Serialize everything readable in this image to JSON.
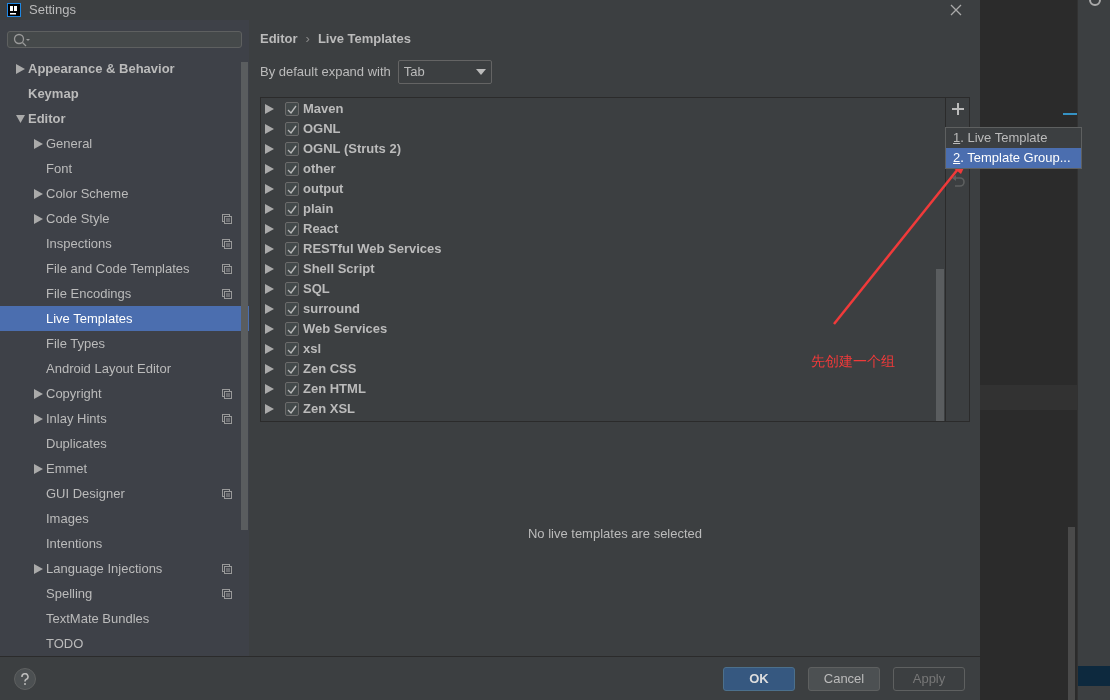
{
  "window": {
    "title": "Settings"
  },
  "sidebar": {
    "items": [
      {
        "label": "Appearance & Behavior",
        "kind": "folder",
        "expanded": false,
        "selected": false,
        "project_level": false
      },
      {
        "label": "Keymap",
        "kind": "leaf",
        "selected": false,
        "project_level": false
      },
      {
        "label": "Editor",
        "kind": "folder",
        "expanded": true,
        "selected": false,
        "project_level": false,
        "children": [
          {
            "label": "General",
            "kind": "folder",
            "expanded": false,
            "selected": false,
            "project_level": false
          },
          {
            "label": "Font",
            "kind": "leaf",
            "selected": false,
            "project_level": false
          },
          {
            "label": "Color Scheme",
            "kind": "folder",
            "expanded": false,
            "selected": false,
            "project_level": false
          },
          {
            "label": "Code Style",
            "kind": "folder",
            "expanded": false,
            "selected": false,
            "project_level": true
          },
          {
            "label": "Inspections",
            "kind": "leaf",
            "selected": false,
            "project_level": true
          },
          {
            "label": "File and Code Templates",
            "kind": "leaf",
            "selected": false,
            "project_level": true
          },
          {
            "label": "File Encodings",
            "kind": "leaf",
            "selected": false,
            "project_level": true
          },
          {
            "label": "Live Templates",
            "kind": "leaf",
            "selected": true,
            "project_level": false
          },
          {
            "label": "File Types",
            "kind": "leaf",
            "selected": false,
            "project_level": false
          },
          {
            "label": "Android Layout Editor",
            "kind": "leaf",
            "selected": false,
            "project_level": false
          },
          {
            "label": "Copyright",
            "kind": "folder",
            "expanded": false,
            "selected": false,
            "project_level": true
          },
          {
            "label": "Inlay Hints",
            "kind": "folder",
            "expanded": false,
            "selected": false,
            "project_level": true
          },
          {
            "label": "Duplicates",
            "kind": "leaf",
            "selected": false,
            "project_level": false
          },
          {
            "label": "Emmet",
            "kind": "folder",
            "expanded": false,
            "selected": false,
            "project_level": false
          },
          {
            "label": "GUI Designer",
            "kind": "leaf",
            "selected": false,
            "project_level": true
          },
          {
            "label": "Images",
            "kind": "leaf",
            "selected": false,
            "project_level": false
          },
          {
            "label": "Intentions",
            "kind": "leaf",
            "selected": false,
            "project_level": false
          },
          {
            "label": "Language Injections",
            "kind": "folder",
            "expanded": false,
            "selected": false,
            "project_level": true
          },
          {
            "label": "Spelling",
            "kind": "leaf",
            "selected": false,
            "project_level": true
          },
          {
            "label": "TextMate Bundles",
            "kind": "leaf",
            "selected": false,
            "project_level": false
          },
          {
            "label": "TODO",
            "kind": "leaf",
            "selected": false,
            "project_level": false
          }
        ]
      }
    ]
  },
  "breadcrumb": {
    "items": [
      "Editor",
      "Live Templates"
    ],
    "separator": "›"
  },
  "expand_with": {
    "label": "By default expand with",
    "value": "Tab"
  },
  "templates": [
    {
      "label": "Maven",
      "checked": true
    },
    {
      "label": "OGNL",
      "checked": true
    },
    {
      "label": "OGNL (Struts 2)",
      "checked": true
    },
    {
      "label": "other",
      "checked": true
    },
    {
      "label": "output",
      "checked": true
    },
    {
      "label": "plain",
      "checked": true
    },
    {
      "label": "React",
      "checked": true
    },
    {
      "label": "RESTful Web Services",
      "checked": true
    },
    {
      "label": "Shell Script",
      "checked": true
    },
    {
      "label": "SQL",
      "checked": true
    },
    {
      "label": "surround",
      "checked": true
    },
    {
      "label": "Web Services",
      "checked": true
    },
    {
      "label": "xsl",
      "checked": true
    },
    {
      "label": "Zen CSS",
      "checked": true
    },
    {
      "label": "Zen HTML",
      "checked": true
    },
    {
      "label": "Zen XSL",
      "checked": true
    }
  ],
  "add_menu": [
    {
      "label": "1. Live Template",
      "selected": false
    },
    {
      "label": "2. Template Group...",
      "selected": true
    }
  ],
  "empty_message": "No live templates are selected",
  "annotation": "先创建一个组",
  "buttons": [
    {
      "label": "OK",
      "kind": "primary",
      "disabled": false
    },
    {
      "label": "Cancel",
      "kind": "normal",
      "disabled": false
    },
    {
      "label": "Apply",
      "kind": "normal",
      "disabled": true
    }
  ]
}
